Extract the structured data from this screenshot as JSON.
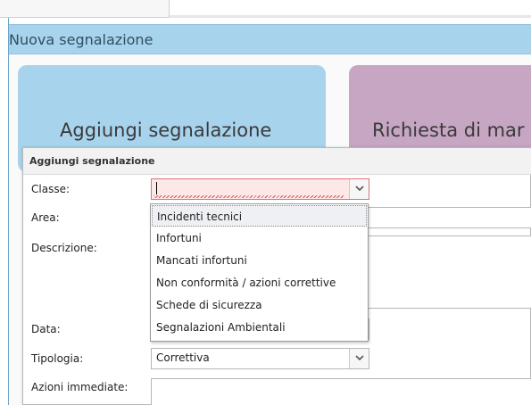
{
  "panel": {
    "title": "Nuova segnalazione"
  },
  "tiles": [
    {
      "label": "Aggiungi segnalazione"
    },
    {
      "label": "Richiesta di mar"
    }
  ],
  "dialog": {
    "title": "Aggiungi segnalazione",
    "fields": {
      "classe": {
        "label": "Classe:",
        "value": ""
      },
      "area": {
        "label": "Area:"
      },
      "descrizione": {
        "label": "Descrizione:"
      },
      "data": {
        "label": "Data:"
      },
      "tipologia": {
        "label": "Tipologia:",
        "value": "Correttiva"
      },
      "azioni": {
        "label": "Azioni immediate:"
      }
    },
    "classe_options": [
      "Incidenti tecnici",
      "Infortuni",
      "Mancati infortuni",
      "Non conformità / azioni correttive",
      "Schede di sicurezza",
      "Segnalazioni Ambientali"
    ],
    "highlighted_option": "Incidenti tecnici"
  },
  "colors": {
    "header_blue": "#a8d3ec",
    "tile_purple": "#c6a6c3",
    "invalid_red": "#e05050"
  }
}
